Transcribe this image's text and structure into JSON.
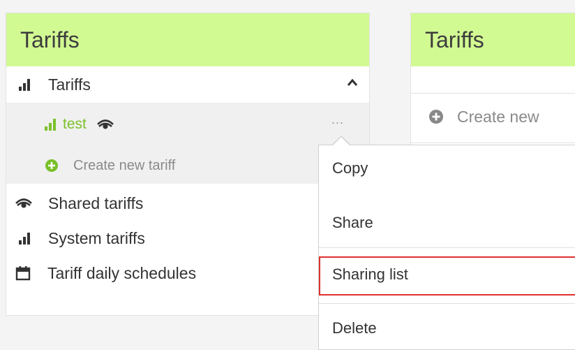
{
  "left_panel": {
    "title": "Tariffs",
    "tariffs_item": {
      "label": "Tariffs",
      "icon": "bar-chart-icon"
    },
    "test_item": {
      "label": "test",
      "icon": "bar-chart-icon",
      "shared_icon": "eye-icon",
      "more_label": "..."
    },
    "create_item": {
      "label": "Create new tariff",
      "icon": "plus-circle-icon"
    },
    "shared_item": {
      "label": "Shared tariffs",
      "icon": "eye-icon"
    },
    "system_item": {
      "label": "System tariffs",
      "icon": "bar-chart-icon"
    },
    "schedules_item": {
      "label": "Tariff daily schedules",
      "icon": "calendar-icon"
    }
  },
  "right_panel": {
    "title": "Tariffs",
    "create_label": "Create new"
  },
  "context_menu": {
    "items": [
      "Copy",
      "Share",
      "Sharing list",
      "Delete"
    ],
    "highlighted": "Sharing list"
  },
  "colors": {
    "header_bg": "#d2fa93",
    "accent_green": "#7ac02a",
    "highlight_border": "#e03030"
  }
}
